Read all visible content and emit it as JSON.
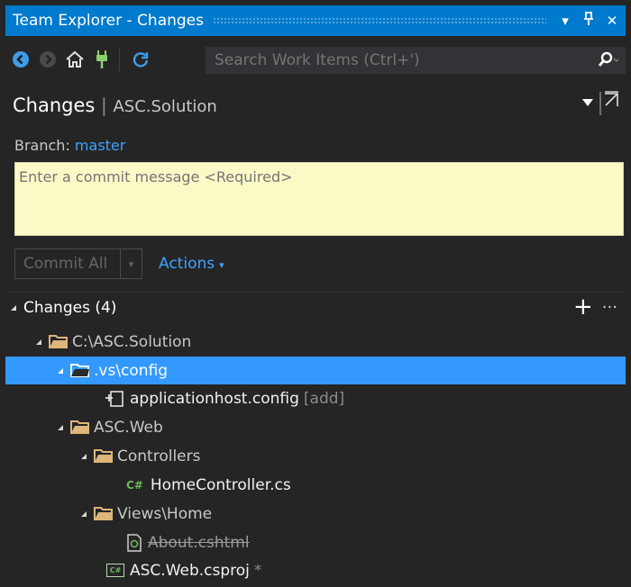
{
  "window": {
    "title": "Team Explorer - Changes",
    "menu_glyph": "▾",
    "pin_glyph": "ᚹ",
    "close_glyph": "✕"
  },
  "toolbar": {
    "search_placeholder": "Search Work Items (Ctrl+')",
    "icons": [
      "back-icon",
      "forward-icon",
      "home-icon",
      "connect-icon",
      "refresh-icon",
      "search-icon"
    ]
  },
  "header": {
    "title": "Changes",
    "separator": "|",
    "subtitle": "ASC.Solution"
  },
  "branch": {
    "label": "Branch:",
    "name": "master"
  },
  "commit": {
    "placeholder": "Enter a commit message <Required>",
    "commit_all_label": "Commit All",
    "actions_label": "Actions",
    "caret": "▾"
  },
  "changes": {
    "header": "Changes (4)",
    "add": "+",
    "more": "···",
    "tree": [
      {
        "label": "C:\\ASC.Solution",
        "kind": "folder"
      },
      {
        "label": ".vs\\config",
        "kind": "folder",
        "selected": true
      },
      {
        "label": "applicationhost.config",
        "kind": "file",
        "status": "[add]"
      },
      {
        "label": "ASC.Web",
        "kind": "folder"
      },
      {
        "label": "Controllers",
        "kind": "folder"
      },
      {
        "label": "HomeController.cs",
        "kind": "cs-file",
        "badge": "C#"
      },
      {
        "label": "Views\\Home",
        "kind": "folder"
      },
      {
        "label": "About.cshtml",
        "kind": "file",
        "deleted": true
      },
      {
        "label": "ASC.Web.csproj",
        "kind": "project",
        "badge": "C#",
        "status": "*"
      }
    ]
  },
  "colors": {
    "accent": "#007acc",
    "selection": "#3399ff",
    "link": "#3ca3ff",
    "commit_box": "#fbf9c6",
    "background": "#252526"
  }
}
